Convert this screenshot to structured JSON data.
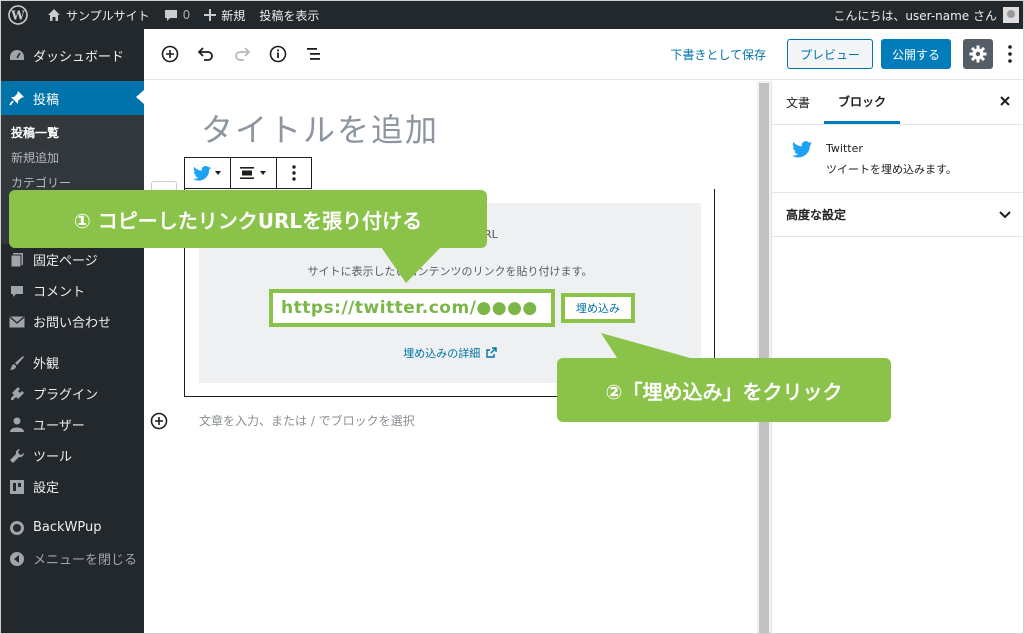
{
  "admin_bar": {
    "site_name": "サンプルサイト",
    "comment_count": "0",
    "new_label": "新規",
    "view_post_label": "投稿を表示",
    "greeting": "こんにちは、user-name さん"
  },
  "sidebar": {
    "items": [
      {
        "label": "ダッシュボード",
        "icon": "dashboard-icon"
      },
      {
        "label": "投稿",
        "icon": "pin-icon",
        "active": true
      },
      {
        "label": "固定ページ",
        "icon": "page-icon"
      },
      {
        "label": "コメント",
        "icon": "comment-icon"
      },
      {
        "label": "お問い合わせ",
        "icon": "mail-icon"
      },
      {
        "label": "外観",
        "icon": "brush-icon"
      },
      {
        "label": "プラグイン",
        "icon": "plugin-icon"
      },
      {
        "label": "ユーザー",
        "icon": "user-icon"
      },
      {
        "label": "ツール",
        "icon": "wrench-icon"
      },
      {
        "label": "設定",
        "icon": "settings-icon"
      },
      {
        "label": "BackWPup",
        "icon": "backwpup-icon"
      },
      {
        "label": "メニューを閉じる",
        "icon": "collapse-icon"
      }
    ],
    "submenu": [
      "投稿一覧",
      "新規追加",
      "カテゴリー"
    ]
  },
  "toolbar": {
    "save_draft": "下書きとして保存",
    "preview": "プレビュー",
    "publish": "公開する"
  },
  "editor": {
    "title_placeholder": "タイトルを追加",
    "embed_label_fragment": "RL",
    "embed_instructions": "サイトに表示したいコンテンツのリンクを貼り付けます。",
    "embed_url_value": "https://twitter.com/●●●●",
    "embed_button": "埋め込み",
    "embed_learn_more": "埋め込みの詳細",
    "paragraph_placeholder": "文章を入力、または / でブロックを選択"
  },
  "settings_sidebar": {
    "tab_document": "文書",
    "tab_block": "ブロック",
    "block_title": "Twitter",
    "block_description": "ツイートを埋め込みます。",
    "advanced_label": "高度な設定"
  },
  "callouts": {
    "step1": "① コピーしたリンクURLを張り付ける",
    "step2": "②「埋め込み」をクリック"
  },
  "colors": {
    "admin_dark": "#23282d",
    "accent_blue": "#0073aa",
    "callout_green": "#8bc34a",
    "twitter_blue": "#1da1f2"
  }
}
